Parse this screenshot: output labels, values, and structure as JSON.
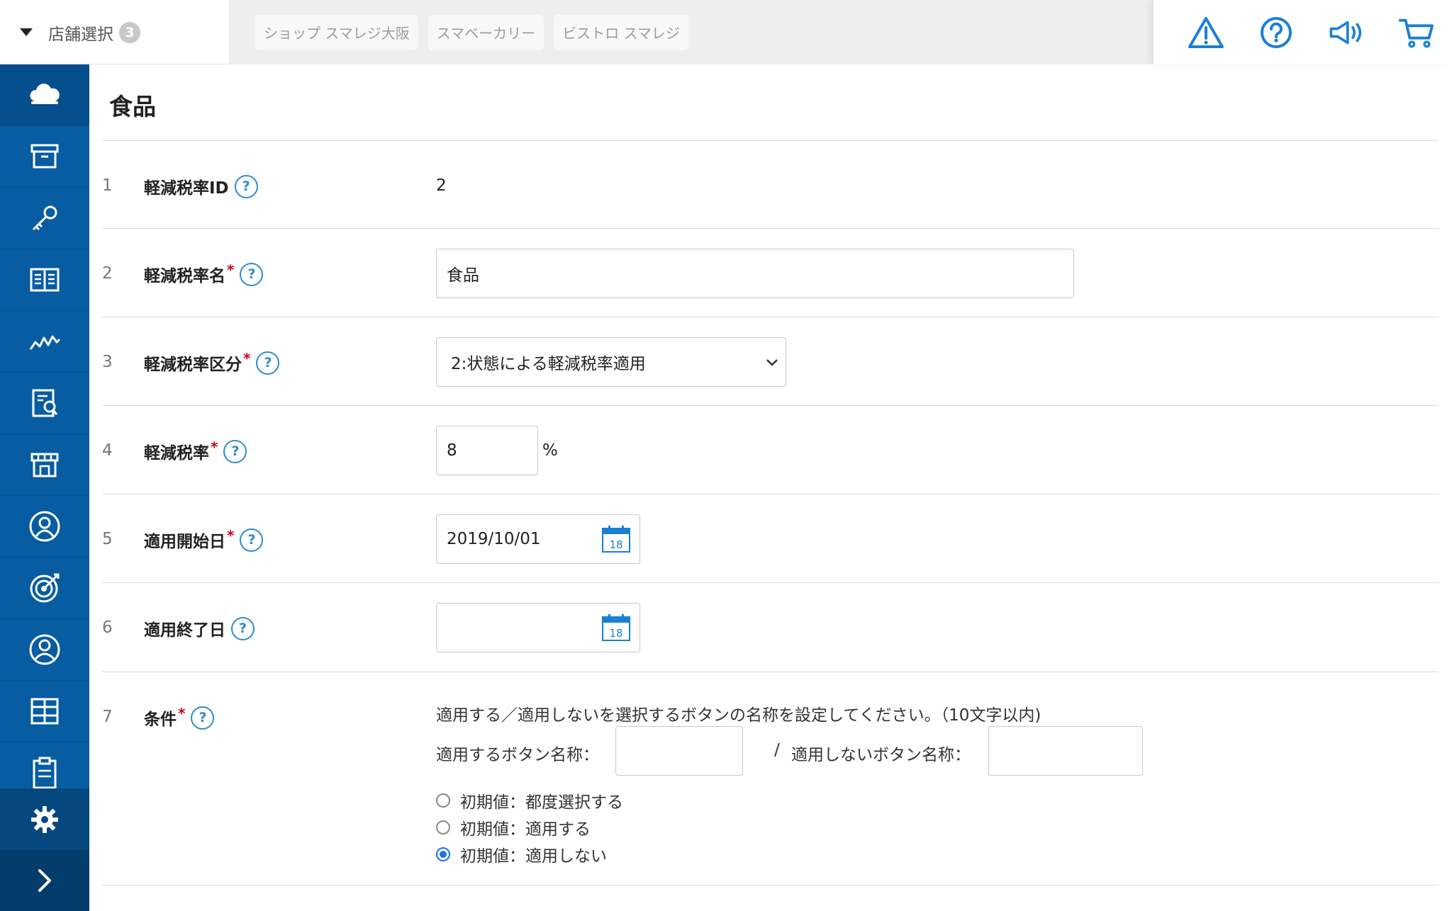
{
  "topbar": {
    "store_select_label": "店舗選択",
    "store_count": "3",
    "store_tabs": [
      "ショップ スマレジ大阪",
      "スマベーカリー",
      "ビストロ スマレジ"
    ],
    "icons": [
      "warning-icon",
      "help-circle-icon",
      "megaphone-icon",
      "cart-icon"
    ],
    "accent_color": "#1a7fd4"
  },
  "sidebar": {
    "background": "#075ca2",
    "icons": [
      "cloud-icon",
      "archive-box-icon",
      "key-icon",
      "book-icon",
      "chart-icon",
      "report-icon",
      "store-icon",
      "staff-icon",
      "target-icon",
      "customer-icon",
      "grid-icon",
      "clipboard-icon"
    ],
    "settings_icon": "gear-icon",
    "expand_icon": "chevron-right-icon"
  },
  "page": {
    "title": "食品",
    "help_mark": "?",
    "rows": [
      {
        "num": "1",
        "label": "軽減税率ID",
        "value": "2"
      },
      {
        "num": "2",
        "label": "軽減税率名",
        "value": "食品"
      },
      {
        "num": "3",
        "label": "軽減税率区分",
        "value": "2:状態による軽減税率適用"
      },
      {
        "num": "4",
        "label": "軽減税率",
        "value": "8",
        "unit": "%"
      },
      {
        "num": "5",
        "label": "適用開始日",
        "value": "2019/10/01",
        "calendar_day": "18"
      },
      {
        "num": "6",
        "label": "適用終了日",
        "value": "",
        "calendar_day": "18"
      },
      {
        "num": "7",
        "label": "条件"
      }
    ],
    "condition": {
      "note": "適用する／適用しないを選択するボタンの名称を設定してください。（10文字以内)",
      "apply_label": "適用するボタン名称：",
      "apply_value": "",
      "separator": "/",
      "not_apply_label": "適用しないボタン名称：",
      "not_apply_value": "",
      "radios": [
        {
          "label": "初期値：都度選択する",
          "checked": false
        },
        {
          "label": "初期値：適用する",
          "checked": false
        },
        {
          "label": "初期値：適用しない",
          "checked": true
        }
      ]
    }
  }
}
